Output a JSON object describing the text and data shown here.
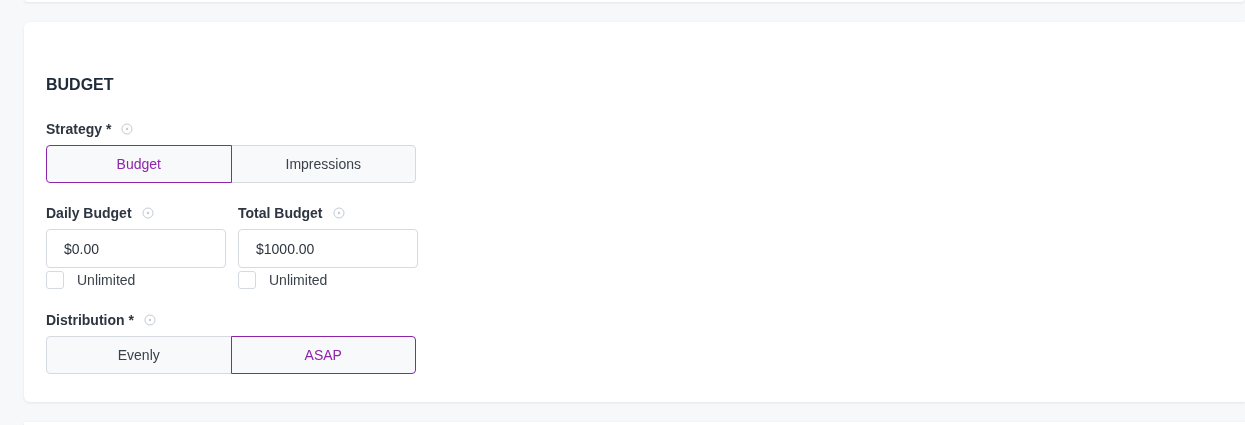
{
  "section": {
    "title": "BUDGET"
  },
  "strategy": {
    "label": "Strategy *",
    "options": [
      {
        "label": "Budget",
        "selected": true
      },
      {
        "label": "Impressions",
        "selected": false
      }
    ]
  },
  "budgets": [
    {
      "label": "Daily Budget",
      "value": "$0.00",
      "unlimited": {
        "label": "Unlimited",
        "checked": false
      }
    },
    {
      "label": "Total Budget",
      "value": "$1000.00",
      "unlimited": {
        "label": "Unlimited",
        "checked": false
      }
    }
  ],
  "distribution": {
    "label": "Distribution *",
    "options": [
      {
        "label": "Evenly",
        "selected": false
      },
      {
        "label": "ASAP",
        "selected": true
      }
    ]
  }
}
